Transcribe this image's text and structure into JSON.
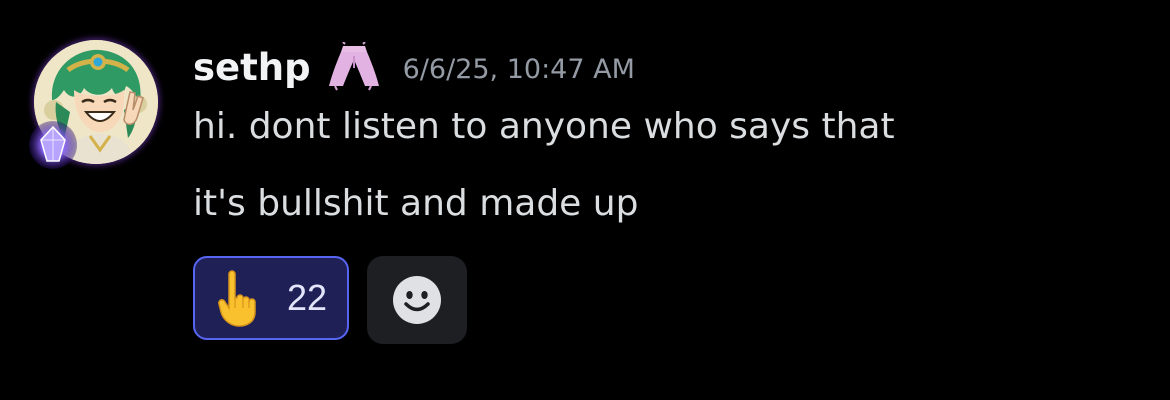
{
  "message": {
    "author": {
      "username": "sethp",
      "avatar_icon": "anime-character-avatar",
      "avatar_decoration_icon": "purple-crystal-decoration-icon",
      "role_icon": "pink-pants-icon"
    },
    "timestamp": "6/6/25, 10:47 AM",
    "lines": [
      "hi. dont listen to anyone who says that",
      "it's bullshit and made up"
    ],
    "reactions": [
      {
        "emoji_icon": "pointing-up-hand-icon",
        "count": "22",
        "reacted_by_me": true
      }
    ],
    "add_reaction_icon": "smiley-face-icon"
  },
  "colors": {
    "background": "#000000",
    "username": "#f2f3f5",
    "timestamp": "#949ba4",
    "message_text": "#dbdee1",
    "reaction_border": "#5865f2",
    "reaction_bg": "#1e2056",
    "add_reaction_bg": "#1e1f22"
  }
}
